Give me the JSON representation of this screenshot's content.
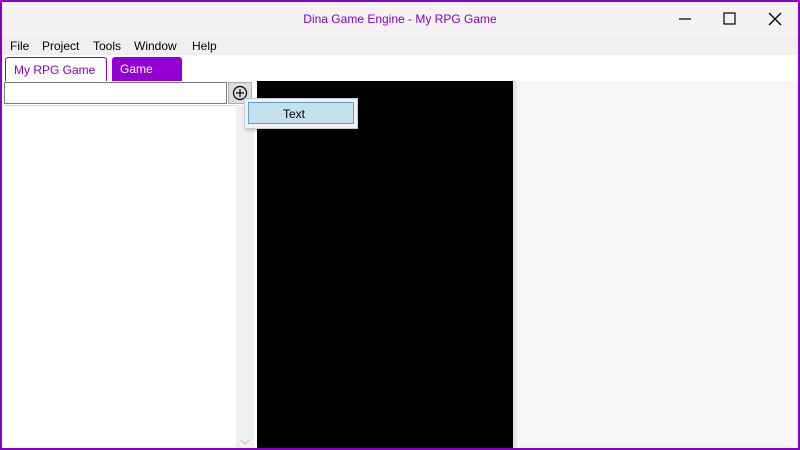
{
  "window": {
    "title": "Dina Game Engine - My RPG Game",
    "accent_color": "#8b00c9",
    "controls": [
      "minimize-icon",
      "maximize-icon",
      "close-icon"
    ]
  },
  "menubar": {
    "items": [
      "File",
      "Project",
      "Tools",
      "Window",
      "Help"
    ]
  },
  "tabs": [
    {
      "label": "My RPG Game",
      "active": false
    },
    {
      "label": "Game",
      "active": true
    }
  ],
  "left_panel": {
    "search_value": "",
    "add_icon": "plus-circle-icon"
  },
  "context_menu": {
    "items": [
      "Text"
    ]
  }
}
